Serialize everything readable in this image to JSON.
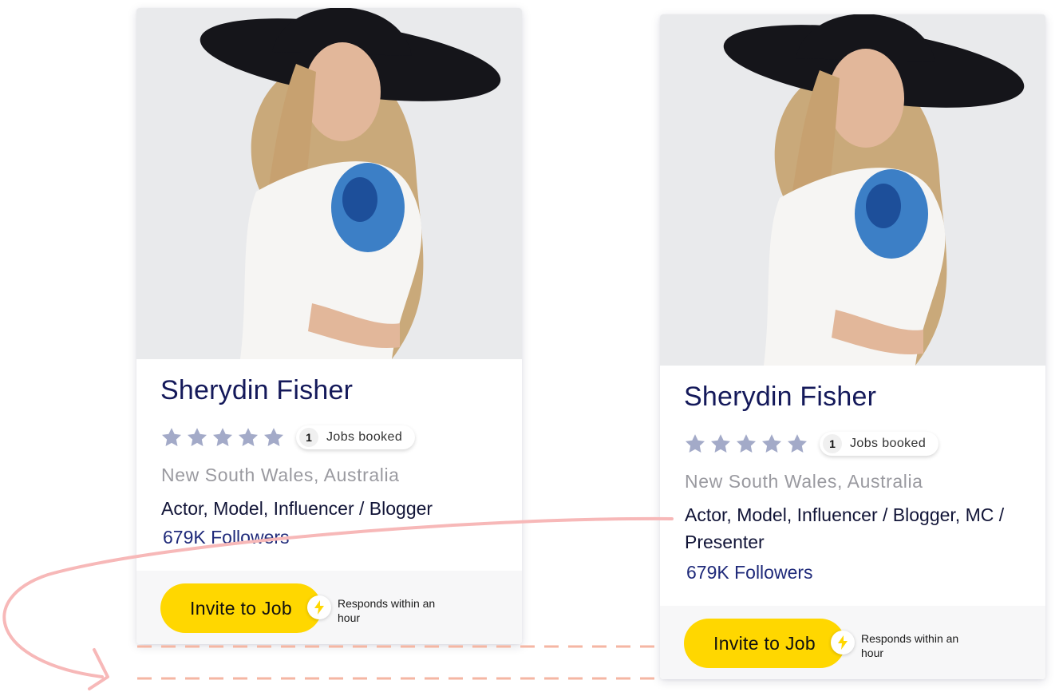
{
  "cards": [
    {
      "name": "Sherydin Fisher",
      "rating": 0,
      "rating_max": 5,
      "jobs_count": "1",
      "jobs_label": "Jobs booked",
      "location": "New South Wales, Australia",
      "skills": "Actor, Model, Influencer / Blogger",
      "followers": "679K Followers",
      "invite_label": "Invite to Job",
      "responds_text": "Responds within an hour",
      "bolt_icon": "lightning-icon"
    },
    {
      "name": "Sherydin Fisher",
      "rating": 0,
      "rating_max": 5,
      "jobs_count": "1",
      "jobs_label": "Jobs booked",
      "location": "New South Wales, Australia",
      "skills": "Actor, Model, Influencer / Blogger, MC / Presenter",
      "followers": "679K Followers",
      "invite_label": "Invite to Job",
      "responds_text": "Responds within an hour",
      "bolt_icon": "lightning-icon"
    }
  ],
  "colors": {
    "name": "#14195a",
    "star_empty": "#a3aac8",
    "button": "#ffd700",
    "followers": "#1f2a7a",
    "arrow": "#f7b8b8",
    "dashed": "#f5b6a3"
  }
}
